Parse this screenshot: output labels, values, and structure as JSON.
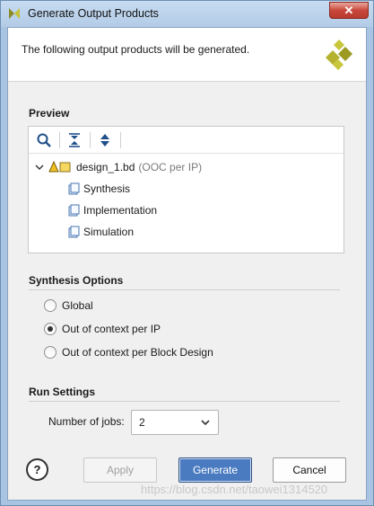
{
  "window": {
    "title": "Generate Output Products",
    "close_label": "✕"
  },
  "header": {
    "text": "The following output products will be generated."
  },
  "preview": {
    "section_title": "Preview",
    "toolbar_icons": [
      "search-icon",
      "collapse-all-icon",
      "expand-all-icon"
    ],
    "tree": {
      "root_label": "design_1.bd",
      "root_note": "(OOC per IP)",
      "children": [
        "Synthesis",
        "Implementation",
        "Simulation"
      ]
    }
  },
  "synthesis_options": {
    "section_title": "Synthesis Options",
    "options": [
      {
        "label": "Global",
        "checked": false
      },
      {
        "label": "Out of context per IP",
        "checked": true
      },
      {
        "label": "Out of context per Block Design",
        "checked": false
      }
    ]
  },
  "run_settings": {
    "section_title": "Run Settings",
    "jobs_label": "Number of jobs:",
    "jobs_value": "2"
  },
  "buttons": {
    "help": "?",
    "apply": "Apply",
    "generate": "Generate",
    "cancel": "Cancel"
  },
  "watermark": "https://blog.csdn.net/taowei1314520",
  "colors": {
    "accent": "#4a7bc0",
    "titlebar": "#b3cbe6",
    "logo": "#b5b32e"
  }
}
